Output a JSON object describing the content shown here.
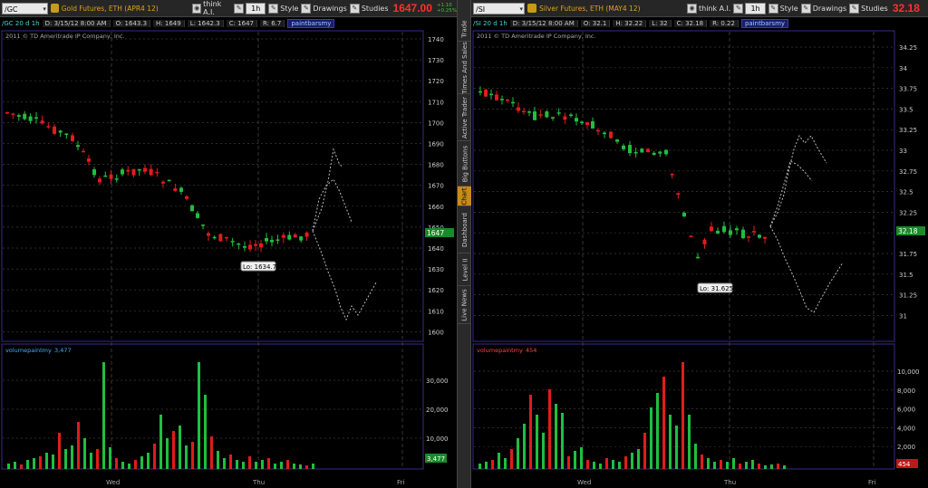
{
  "charts": [
    {
      "symbol": "/GC",
      "description": "Gold Futures, ETH (APR4 12)",
      "toolbar": {
        "think": "think A.I.",
        "timeframe": "1h",
        "style": "Style",
        "drawings": "Drawings",
        "studies": "Studies"
      },
      "last_price": "1647.00",
      "change_up": "+1.10",
      "change_pct": "+0.25%",
      "info": {
        "sym": "/GC 20 d 1h",
        "date": "D: 3/15/12 8:00 AM",
        "open": "O: 1643.3",
        "high": "H: 1649",
        "low": "L: 1642.3",
        "close": "C: 1647",
        "range": "R: 6.7",
        "study": "paintbarsmy"
      },
      "copyright": "2011 © TD Ameritrade IP Company, Inc.",
      "price_axis": [
        "1740",
        "1730",
        "1720",
        "1710",
        "1700",
        "1690",
        "1680",
        "1670",
        "1660",
        "1650",
        "1640",
        "1630",
        "1620",
        "1610",
        "1600"
      ],
      "price_tag": "1647",
      "low_label": "Lo: 1634.7",
      "volume_study": "volumepaintmy",
      "volume_value": "3,477",
      "volume_axis": [
        "30,000",
        "20,000",
        "10,000"
      ],
      "volume_tag": "3,477",
      "time_axis": [
        "Wed",
        "Thu",
        "Fri"
      ],
      "accent": "#33cc33"
    },
    {
      "symbol": "/SI",
      "description": "Silver Futures, ETH (MAY4 12)",
      "toolbar": {
        "think": "think A.I.",
        "timeframe": "1h",
        "style": "Style",
        "drawings": "Drawings",
        "studies": "Studies"
      },
      "last_price": "32.18",
      "change_up": "",
      "change_pct": "",
      "info": {
        "sym": "/SI 20 d 1h",
        "date": "D: 3/15/12 8:00 AM",
        "open": "O: 32.1",
        "high": "H: 32.22",
        "low": "L: 32",
        "close": "C: 32.18",
        "range": "R: 0.22",
        "study": "paintbarsmy"
      },
      "copyright": "2011 © TD Ameritrade IP Company, Inc.",
      "price_axis": [
        "34.25",
        "34",
        "33.75",
        "33.5",
        "33.25",
        "33",
        "32.75",
        "32.5",
        "32.25",
        "32",
        "31.75",
        "31.5",
        "31.25",
        "31"
      ],
      "price_tag": "32.18",
      "low_label": "Lo: 31.625",
      "volume_study": "volumepaintmy",
      "volume_value": "454",
      "volume_axis": [
        "10,000",
        "8,000",
        "6,000",
        "4,000",
        "2,000"
      ],
      "volume_tag": "454",
      "time_axis": [
        "Wed",
        "Thu",
        "Fri"
      ],
      "accent": "#ff3030"
    }
  ],
  "side_tabs": [
    "Trade",
    "Times And Sales",
    "Active Trader",
    "Big Buttons",
    "Chart",
    "Dashboard",
    "Level II",
    "Live News"
  ],
  "active_tab": "Chart",
  "colors": {
    "up": "#1fbf3f",
    "down": "#e01c1c",
    "grid": "#3a3a3a",
    "bg": "#000000",
    "projection": "#bbbbbb"
  }
}
